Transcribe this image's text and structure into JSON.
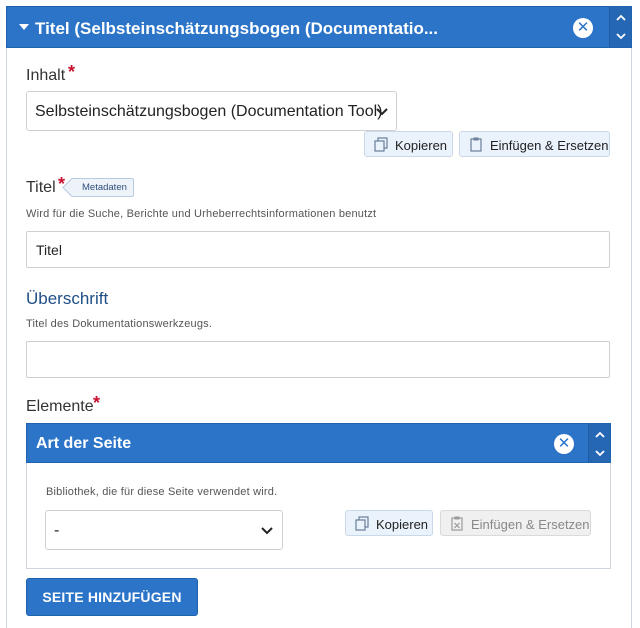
{
  "main_panel": {
    "title": "Titel (Selbsteinschätzungsbogen (Documentatio..."
  },
  "inhalt": {
    "label": "Inhalt",
    "required_mark": "*",
    "selected": "Selbsteinschätzungsbogen (Documentation Tool)",
    "copy_label": "Kopieren",
    "paste_label": "Einfügen & Ersetzen"
  },
  "titel": {
    "label": "Titel",
    "required_mark": "*",
    "badge": "Metadaten",
    "description": "Wird für die Suche, Berichte und Urheberrechtsinformationen benutzt",
    "value": "Titel"
  },
  "ueberschrift": {
    "label": "Überschrift",
    "description": "Titel des Dokumentationswerkzeugs.",
    "value": ""
  },
  "elemente": {
    "label": "Elemente",
    "required_mark": "*",
    "sub_panel": {
      "title": "Art der Seite",
      "description": "Bibliothek, die für diese Seite verwendet wird.",
      "selected": "-",
      "copy_label": "Kopieren",
      "paste_label": "Einfügen & Ersetzen"
    },
    "add_button": "SEITE HINZUFÜGEN"
  },
  "colors": {
    "accent": "#2b74c8",
    "required": "#c8102e"
  }
}
